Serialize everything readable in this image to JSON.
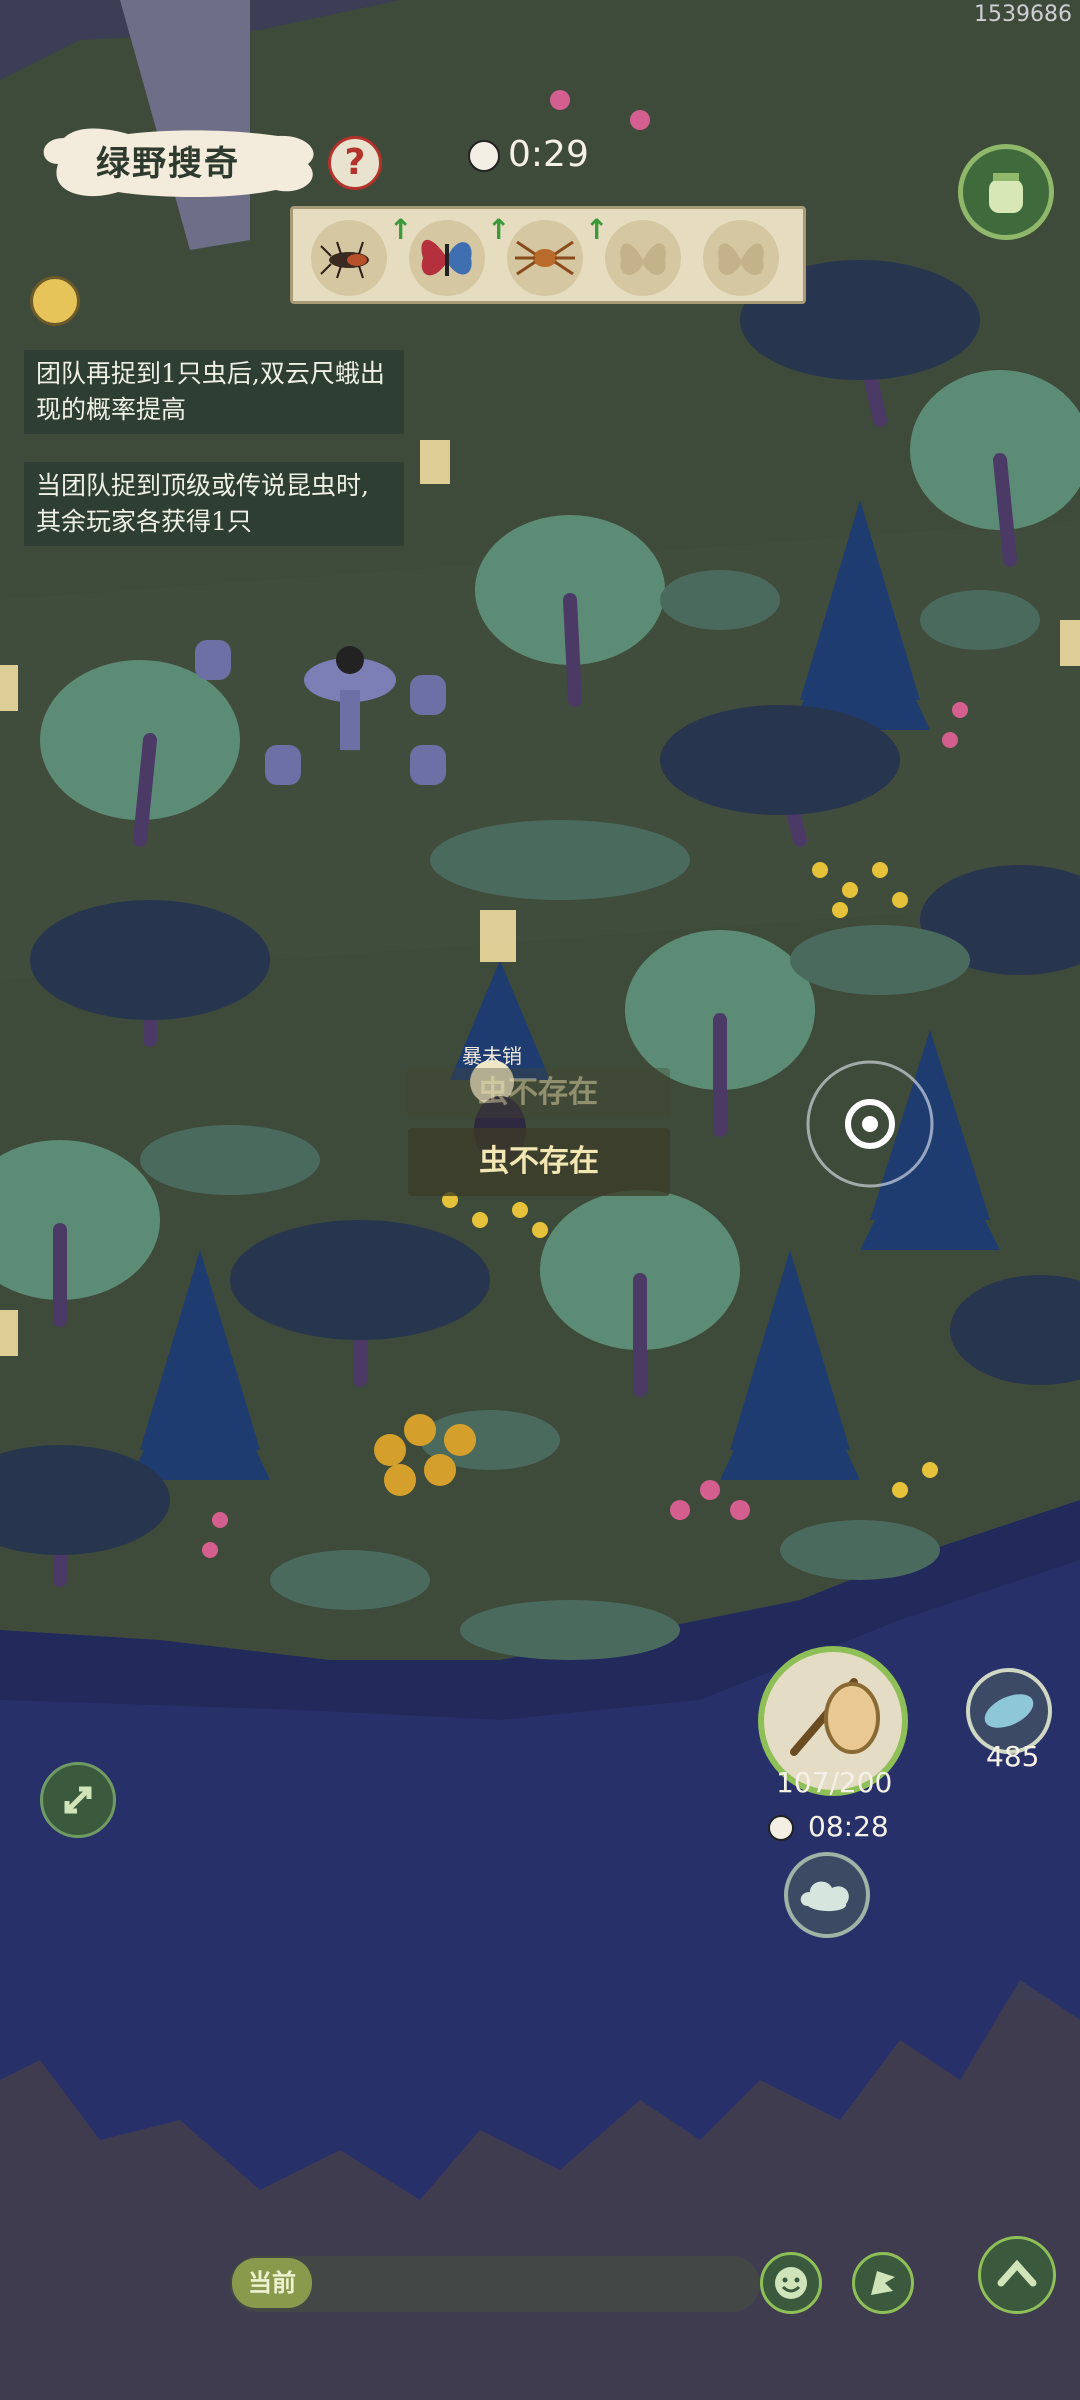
{
  "user_id": "1539686",
  "title": "绿野搜奇",
  "timer": "0:29",
  "insects": [
    {
      "name": "beetle",
      "boosted": true
    },
    {
      "name": "butterfly",
      "boosted": true
    },
    {
      "name": "spider",
      "boosted": true
    },
    {
      "name": "moth-locked",
      "boosted": false
    },
    {
      "name": "moth-locked",
      "boosted": false
    }
  ],
  "notices": [
    "团队再捉到1只虫后,双云尺蛾出现的概率提高",
    "当团队捉到顶级或传说昆虫时,其余玩家各获得1只"
  ],
  "toasts": {
    "small_label": "暴未销",
    "faded": "虫不存在",
    "main": "虫不存在"
  },
  "net_durability": "107/200",
  "countdown": "08:28",
  "bait_count": "485",
  "chat": {
    "current_label": "当前"
  },
  "colors": {
    "ground": "#3e4a3a",
    "cliff": "#28306a",
    "accent_green": "#8fbf57",
    "help_red": "#b3322b"
  }
}
